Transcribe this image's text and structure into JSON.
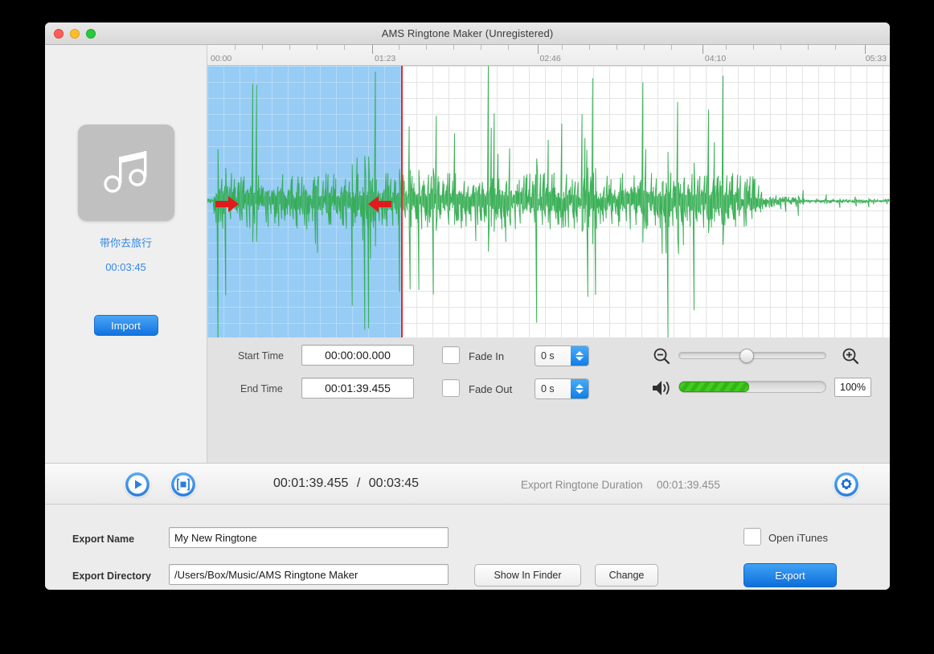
{
  "window": {
    "title": "AMS Ringtone Maker (Unregistered)",
    "traffic_lights": [
      "close",
      "minimize",
      "zoom"
    ]
  },
  "sidebar": {
    "album_art_icon": "music-note-icon",
    "song_title": "带你去旅行",
    "song_duration": "00:03:45",
    "import_label": "Import"
  },
  "ruler": {
    "labels": [
      "00:00",
      "01:23",
      "02:46",
      "04:10",
      "05:33"
    ],
    "label_positions": [
      0,
      24.2,
      48.4,
      72.6,
      96.4
    ]
  },
  "waveform": {
    "selection_start_pct": 0,
    "selection_end_pct": 28.4,
    "playhead_pct": 28.4,
    "start_marker_icon": "arrow-right-marker-icon",
    "end_marker_icon": "arrow-left-marker-icon",
    "wave_color": "#2eaa4c",
    "selection_color": "#97ccf5",
    "playhead_color": "#e8262a"
  },
  "controls": {
    "start_time_label": "Start Time",
    "start_time_value": "00:00:00.000",
    "end_time_label": "End Time",
    "end_time_value": "00:01:39.455",
    "fade_in_label": "Fade In",
    "fade_in_checked": false,
    "fade_in_value": "0 s",
    "fade_out_label": "Fade Out",
    "fade_out_checked": false,
    "fade_out_value": "0 s",
    "zoom_out_icon": "magnifier-minus-icon",
    "zoom_in_icon": "magnifier-plus-icon",
    "zoom_position_pct": 46,
    "volume_icon": "speaker-icon",
    "volume_fill_pct": 48,
    "volume_value": "100%"
  },
  "transport": {
    "play_icon": "play-icon",
    "loop_icon": "selection-play-icon",
    "current_time": "00:01:39.455",
    "separator": "/",
    "total_time": "00:03:45",
    "export_duration_label": "Export Ringtone Duration",
    "export_duration_value": "00:01:39.455",
    "settings_icon": "gear-icon"
  },
  "export": {
    "name_label": "Export Name",
    "name_value": "My New Ringtone",
    "directory_label": "Export Directory",
    "directory_value": "/Users/Box/Music/AMS Ringtone Maker",
    "show_in_finder_label": "Show In Finder",
    "change_label": "Change",
    "open_itunes_label": "Open iTunes",
    "open_itunes_checked": false,
    "export_label": "Export"
  },
  "colors": {
    "accent_blue": "#1273e0",
    "link_blue": "#3388e8",
    "wave_green": "#2eaa4c",
    "playhead_red": "#e8262a",
    "volume_green": "#41cd20"
  }
}
